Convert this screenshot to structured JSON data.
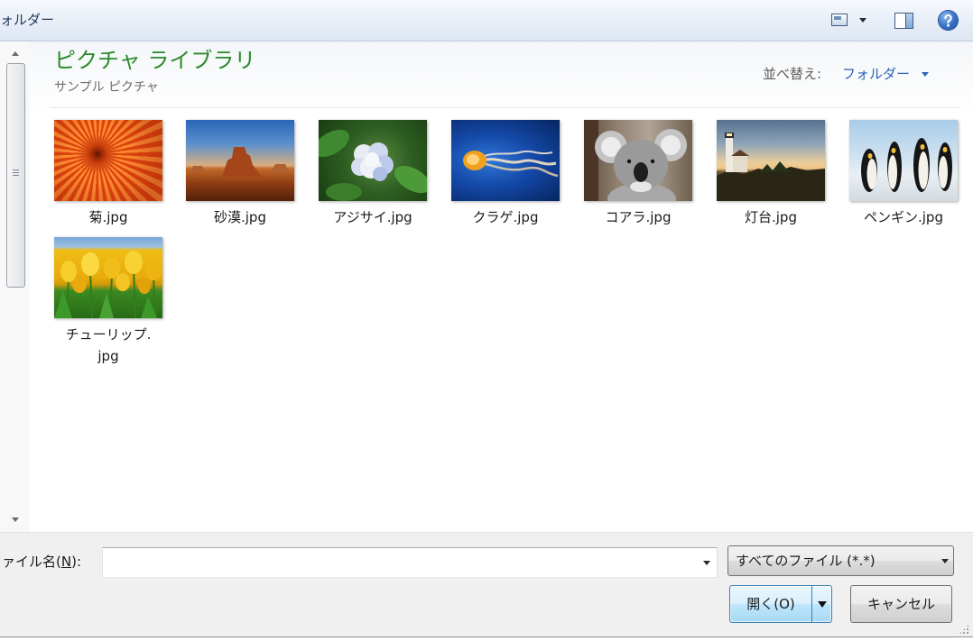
{
  "toolbar": {
    "title": "ォルダー",
    "icons": [
      "view-options-icon",
      "preview-pane-icon",
      "help-icon"
    ]
  },
  "library": {
    "title": "ピクチャ ライブラリ",
    "subtitle": "サンプル ピクチャ",
    "sort_label": "並べ替え:",
    "sort_value": "フォルダー"
  },
  "files": [
    {
      "label": "菊.jpg"
    },
    {
      "label": "砂漠.jpg"
    },
    {
      "label": "アジサイ.jpg"
    },
    {
      "label": "クラゲ.jpg"
    },
    {
      "label": "コアラ.jpg"
    },
    {
      "label": "灯台.jpg"
    },
    {
      "label": "ペンギン.jpg"
    },
    {
      "label_lines": [
        "チューリップ.",
        "jpg"
      ]
    }
  ],
  "footer": {
    "filename_label": {
      "before": "ァイル名(",
      "accesskey": "N",
      "after": "):"
    },
    "filename_value": "",
    "file_type": "すべてのファイル (*.*)",
    "open_button": "開く(O)",
    "cancel_button": "キャンセル"
  },
  "colors": {
    "toolbar_title": "#1e395b",
    "library_title": "#2b8a2b",
    "sort_value": "#2c63b8"
  }
}
